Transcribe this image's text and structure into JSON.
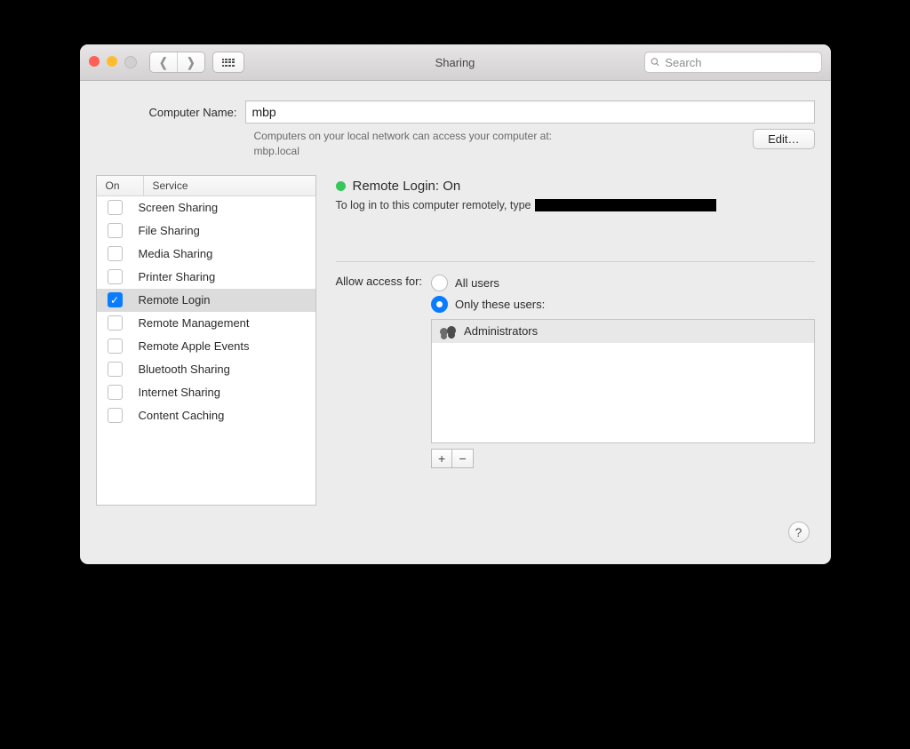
{
  "window": {
    "title": "Sharing"
  },
  "search": {
    "placeholder": "Search"
  },
  "computer": {
    "label": "Computer Name:",
    "value": "mbp",
    "hint_line1": "Computers on your local network can access your computer at:",
    "hint_line2": "mbp.local",
    "edit": "Edit…"
  },
  "services": {
    "head_on": "On",
    "head_service": "Service",
    "items": [
      {
        "label": "Screen Sharing",
        "on": false,
        "selected": false
      },
      {
        "label": "File Sharing",
        "on": false,
        "selected": false
      },
      {
        "label": "Media Sharing",
        "on": false,
        "selected": false
      },
      {
        "label": "Printer Sharing",
        "on": false,
        "selected": false
      },
      {
        "label": "Remote Login",
        "on": true,
        "selected": true
      },
      {
        "label": "Remote Management",
        "on": false,
        "selected": false
      },
      {
        "label": "Remote Apple Events",
        "on": false,
        "selected": false
      },
      {
        "label": "Bluetooth Sharing",
        "on": false,
        "selected": false
      },
      {
        "label": "Internet Sharing",
        "on": false,
        "selected": false
      },
      {
        "label": "Content Caching",
        "on": false,
        "selected": false
      }
    ]
  },
  "detail": {
    "status_title": "Remote Login: On",
    "status_color": "#35c759",
    "instruction": "To log in to this computer remotely, type",
    "access_label": "Allow access for:",
    "option_all": "All users",
    "option_only": "Only these users:",
    "selected_option": "only",
    "users": [
      {
        "name": "Administrators"
      }
    ],
    "add": "+",
    "remove": "−"
  },
  "help": "?"
}
